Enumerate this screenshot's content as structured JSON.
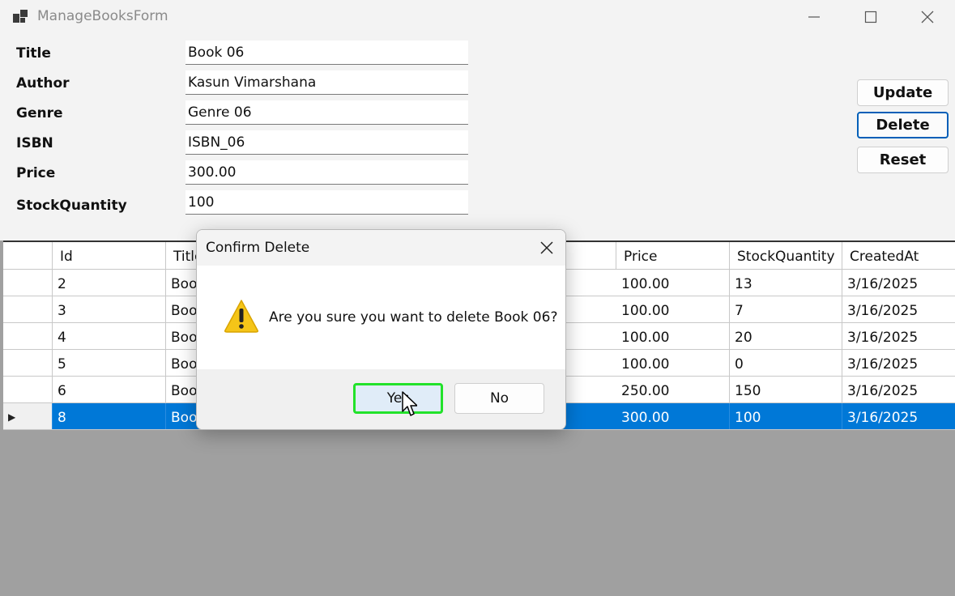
{
  "window": {
    "title": "ManageBooksForm",
    "icon": "app-icon",
    "controls": [
      "minimize-icon",
      "maximize-icon",
      "close-icon"
    ]
  },
  "form": {
    "fields": [
      {
        "label": "Title",
        "value": "Book 06"
      },
      {
        "label": "Author",
        "value": "Kasun Vimarshana"
      },
      {
        "label": "Genre",
        "value": "Genre 06"
      },
      {
        "label": "ISBN",
        "value": "ISBN_06"
      },
      {
        "label": "Price",
        "value": "300.00"
      },
      {
        "label": "StockQuantity",
        "value": "100"
      }
    ],
    "buttons": {
      "update": "Update",
      "delete": "Delete",
      "reset": "Reset"
    }
  },
  "grid": {
    "columns": [
      "",
      "Id",
      "Title",
      "",
      "",
      "Price",
      "StockQuantity",
      "CreatedAt"
    ],
    "rows": [
      {
        "indicator": "",
        "id": "2",
        "title": "Boo",
        "price": "100.00",
        "stock": "13",
        "created": "3/16/2025"
      },
      {
        "indicator": "",
        "id": "3",
        "title": "Boo",
        "price": "100.00",
        "stock": "7",
        "created": "3/16/2025"
      },
      {
        "indicator": "",
        "id": "4",
        "title": "Boo",
        "price": "100.00",
        "stock": "20",
        "created": "3/16/2025"
      },
      {
        "indicator": "",
        "id": "5",
        "title": "Boo",
        "price": "100.00",
        "stock": "0",
        "created": "3/16/2025"
      },
      {
        "indicator": "",
        "id": "6",
        "title": "Boo",
        "price": "250.00",
        "stock": "150",
        "created": "3/16/2025"
      },
      {
        "indicator": "▶",
        "id": "8",
        "title": "Boo",
        "price": "300.00",
        "stock": "100",
        "created": "3/16/2025"
      }
    ],
    "selected_row_index": 5
  },
  "dialog": {
    "title": "Confirm Delete",
    "message": "Are you sure you want to delete Book 06?",
    "icon": "warning-icon",
    "yes_label": "Yes",
    "no_label": "No"
  },
  "colors": {
    "selection": "#0078d7",
    "highlight": "#22e22a",
    "focus_border": "#005fb8",
    "warning": "#f5c518"
  }
}
